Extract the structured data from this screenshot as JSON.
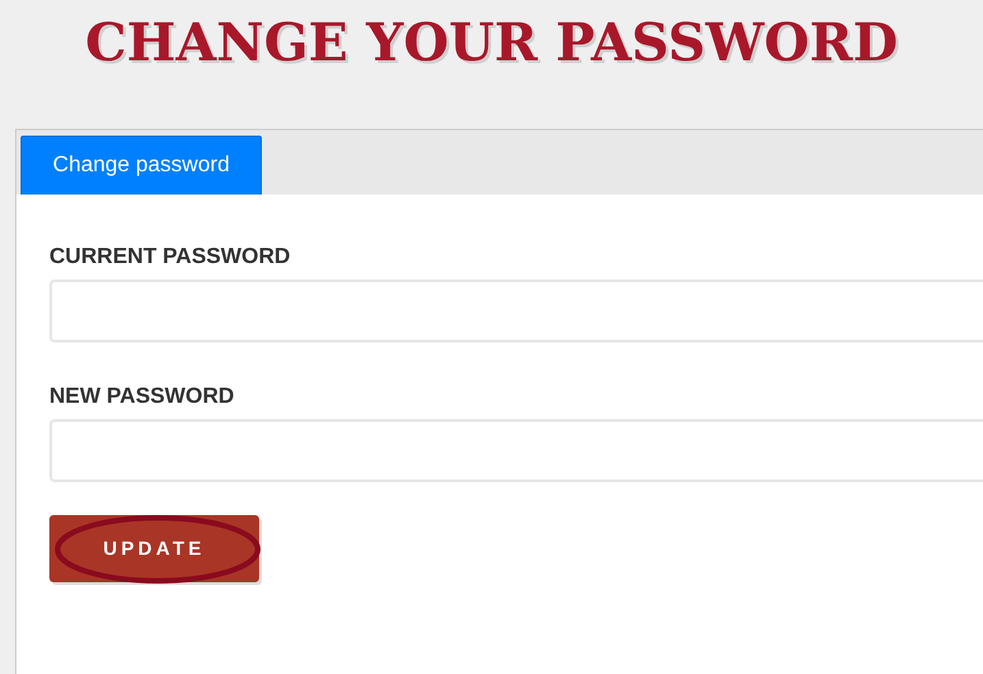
{
  "heading": "CHANGE YOUR PASSWORD",
  "tabs": [
    {
      "label": "Change password",
      "selected": true
    }
  ],
  "fields": [
    {
      "label": "CURRENT PASSWORD"
    },
    {
      "label": "NEW PASSWORD"
    }
  ],
  "button": {
    "label": "UPDATE",
    "circled": true
  }
}
